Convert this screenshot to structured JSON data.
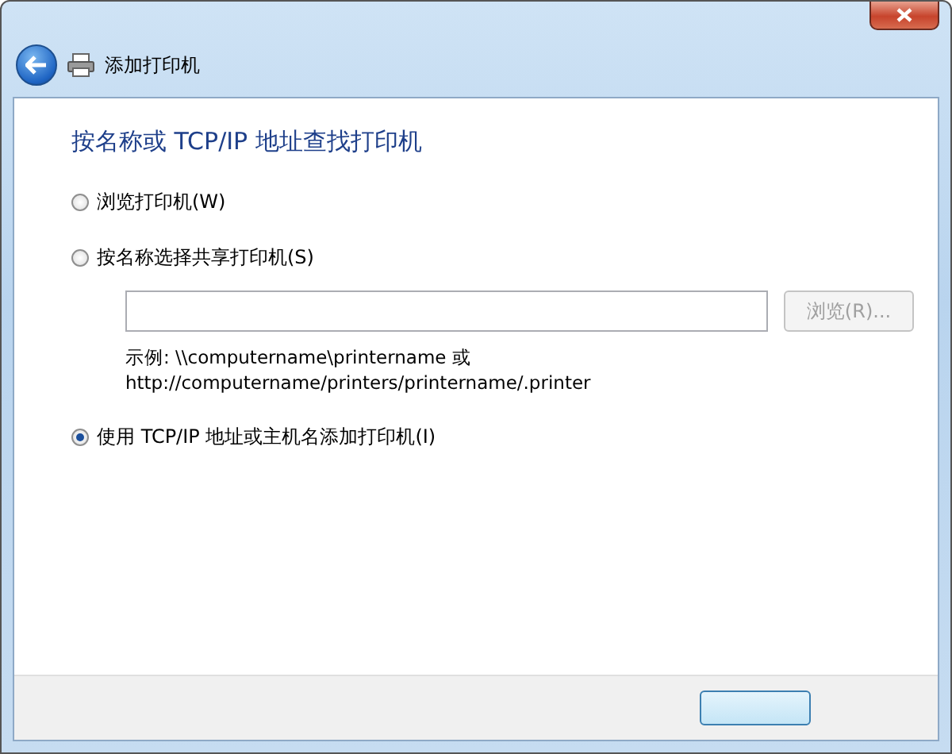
{
  "window": {
    "title": "添加打印机"
  },
  "heading": "按名称或 TCP/IP 地址查找打印机",
  "options": [
    {
      "kind": "radio",
      "label": "浏览打印机(W)",
      "selected": false
    },
    {
      "kind": "radio_with_field",
      "label": "按名称选择共享打印机(S)",
      "selected": false,
      "browse_button": {
        "label": "浏览(R)...",
        "disabled": true
      },
      "hint_lines": [
        "示例: \\\\computername\\printername 或",
        "http://computername/printers/printername/.printer"
      ]
    },
    {
      "kind": "radio",
      "label": "使用 TCP/IP 地址或主机名添加打印机(I)",
      "selected": true
    }
  ]
}
